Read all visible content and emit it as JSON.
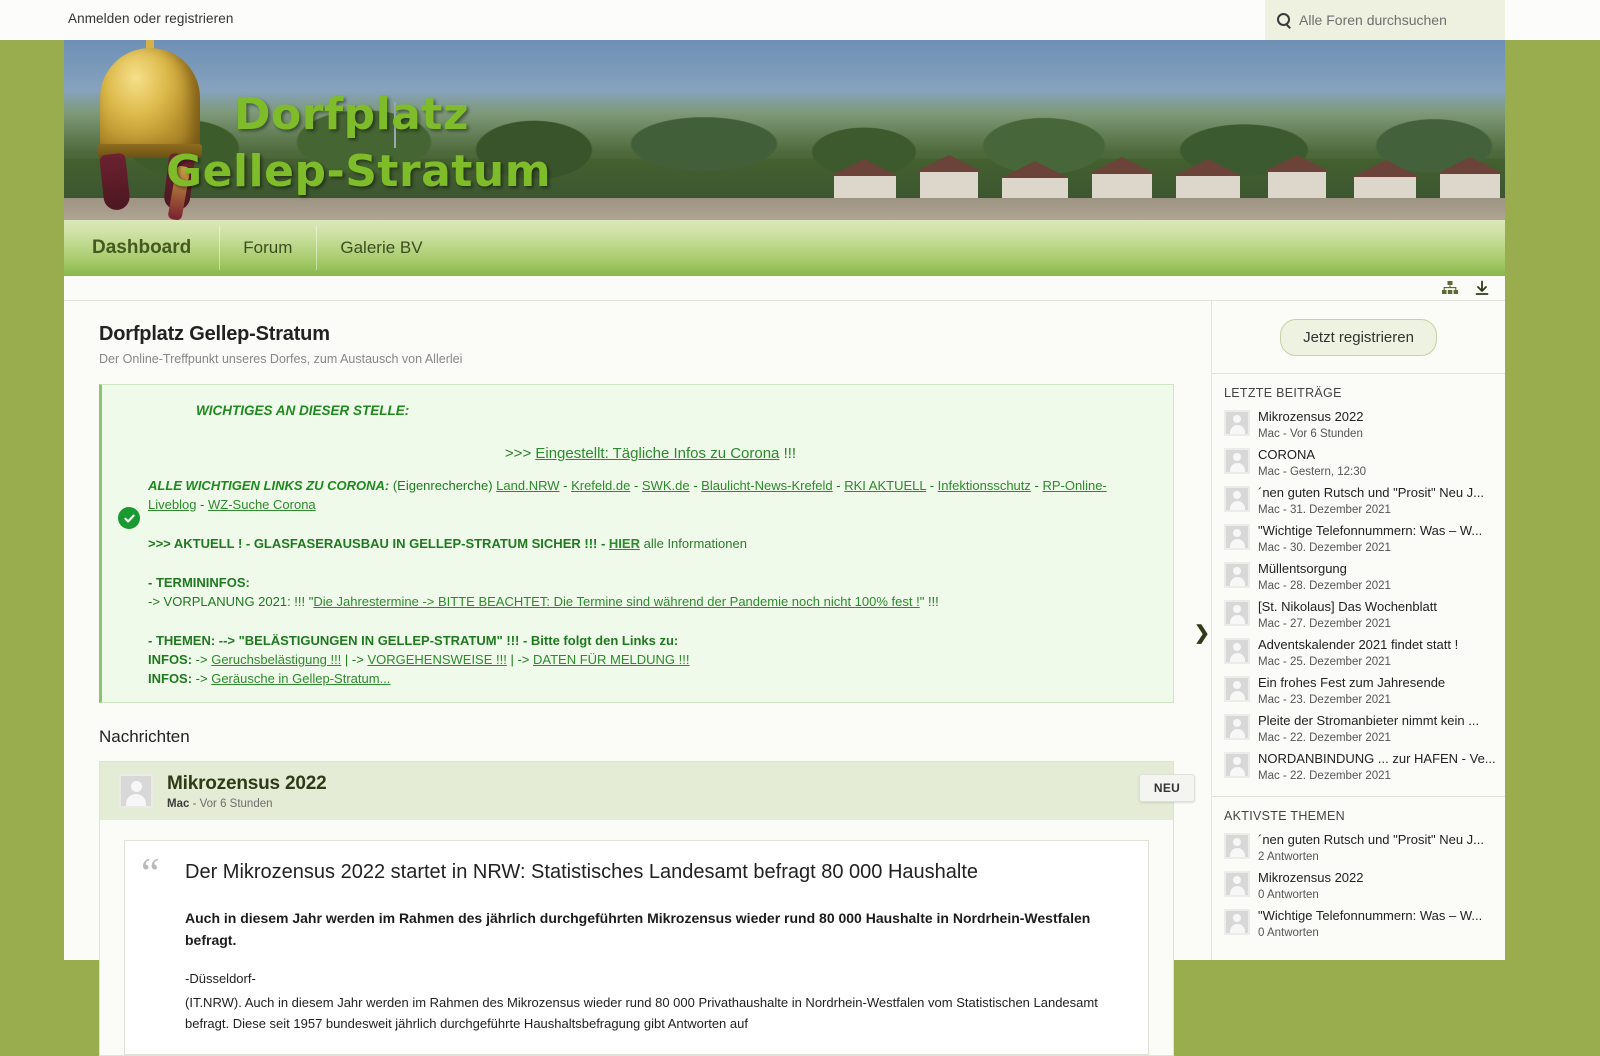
{
  "topbar": {
    "login_label": "Anmelden oder registrieren",
    "search_placeholder": "Alle Foren durchsuchen",
    "search_value": ""
  },
  "banner": {
    "title_line1": "Dorfplatz",
    "title_line2": "Gellep-Stratum"
  },
  "nav": {
    "items": [
      {
        "label": "Dashboard",
        "active": true
      },
      {
        "label": "Forum",
        "active": false
      },
      {
        "label": "Galerie BV",
        "active": false
      }
    ]
  },
  "crumbbar": {
    "sitemap_icon": "sitemap-icon",
    "download_icon": "download-icon"
  },
  "page": {
    "title": "Dorfplatz Gellep-Stratum",
    "subtitle": "Der Online-Treffpunkt unseres Dorfes, zum Austausch von Allerlei",
    "section_news": "Nachrichten"
  },
  "announcement": {
    "heading": "WICHTIGES AN DIESER STELLE:",
    "center_prefix": ">>> ",
    "center_link": "Eingestellt: Tägliche Infos zu Corona",
    "center_suffix": " !!!",
    "links_label": "ALLE WICHTIGEN LINKS ZU CORONA:",
    "links_note": " (Eigenrecherche) ",
    "links": [
      "Land.NRW",
      "Krefeld.de",
      "SWK.de",
      "Blaulicht-News-Krefeld",
      "RKI AKTUELL",
      "Infektionsschutz",
      "RP-Online-Liveblog",
      "WZ-Suche Corona"
    ],
    "check_icon": "check-circle-icon",
    "aktuell_prefix": ">>> AKTUELL ! - GLASFASERAUSBAU IN GELLEP-STRATUM SICHER !!! - ",
    "aktuell_link": "HIER",
    "aktuell_suffix": " alle Informationen",
    "termin_heading": "- TERMININFOS:",
    "termin_prefix": "-> VORPLANUNG 2021: !!! \"",
    "termin_link": "Die Jahrestermine -> BITTE BEACHTET: Die Termine sind während der Pandemie noch nicht 100% fest !",
    "termin_suffix": "\" !!!",
    "themen_heading": "- THEMEN: --> \"BELÄSTIGUNGEN IN GELLEP-STRATUM\" !!! - Bitte folgt den Links zu:",
    "infos_label_1": "INFOS:",
    "infos_links_1": [
      "Geruchsbelästigung !!!",
      "VORGEHENSWEISE !!!",
      "DATEN FÜR MELDUNG !!!"
    ],
    "infos_label_2": "INFOS:",
    "infos_links_2": [
      "Geräusche in Gellep-Stratum..."
    ]
  },
  "news_post": {
    "title": "Mikrozensus 2022",
    "author": "Mac",
    "time": "Vor 6 Stunden",
    "badge": "NEU",
    "quote_title": "Der Mikrozensus 2022 startet in NRW: Statistisches Landesamt befragt 80 000 Haushalte",
    "lead": "Auch in diesem Jahr werden im Rahmen des jährlich durchgeführten Mikrozensus wieder rund 80 000 Haushalte in Nordrhein-Westfalen befragt.",
    "city": "-Düsseldorf-",
    "paragraph": "(IT.NRW). Auch in diesem Jahr werden im Rahmen des Mikrozensus wieder rund 80 000 Privathaushalte in Nordrhein-Westfalen vom Statistischen Landesamt befragt. Diese seit 1957 bundesweit jährlich durchgeführte Haushaltsbefragung gibt Antworten auf"
  },
  "sidebar": {
    "register_label": "Jetzt registrieren",
    "chevron_icon": "chevron-right-icon",
    "recent_heading": "LETZTE BEITRÄGE",
    "recent_posts": [
      {
        "title": "Mikrozensus 2022",
        "meta": "Mac - Vor 6 Stunden"
      },
      {
        "title": "CORONA",
        "meta": "Mac - Gestern, 12:30"
      },
      {
        "title": "´nen guten Rutsch und \"Prosit\" Neu J...",
        "meta": "Mac - 31. Dezember 2021"
      },
      {
        "title": "\"Wichtige Telefonnummern: Was – W...",
        "meta": "Mac - 30. Dezember 2021"
      },
      {
        "title": "Müllentsorgung",
        "meta": "Mac - 28. Dezember 2021"
      },
      {
        "title": "[St. Nikolaus] Das Wochenblatt",
        "meta": "Mac - 27. Dezember 2021"
      },
      {
        "title": "Adventskalender 2021 findet statt !",
        "meta": "Mac - 25. Dezember 2021"
      },
      {
        "title": "Ein frohes Fest zum Jahresende",
        "meta": "Mac - 23. Dezember 2021"
      },
      {
        "title": "Pleite der Stromanbieter nimmt kein ...",
        "meta": "Mac - 22. Dezember 2021"
      },
      {
        "title": "NORDANBINDUNG ... zur HAFEN - Ve...",
        "meta": "Mac - 22. Dezember 2021"
      }
    ],
    "active_heading": "AKTIVSTE THEMEN",
    "active_topics": [
      {
        "title": "´nen guten Rutsch und \"Prosit\" Neu J...",
        "meta": "2 Antworten"
      },
      {
        "title": "Mikrozensus 2022",
        "meta": "0 Antworten"
      },
      {
        "title": "\"Wichtige Telefonnummern: Was – W...",
        "meta": "0 Antworten"
      }
    ]
  },
  "colors": {
    "page_bg": "#9aad4e",
    "nav_green": "#a8cc6d",
    "announce_bg": "#f0faeb",
    "link_green": "#2d8a2d",
    "banner_title": "#7fbc2a"
  }
}
